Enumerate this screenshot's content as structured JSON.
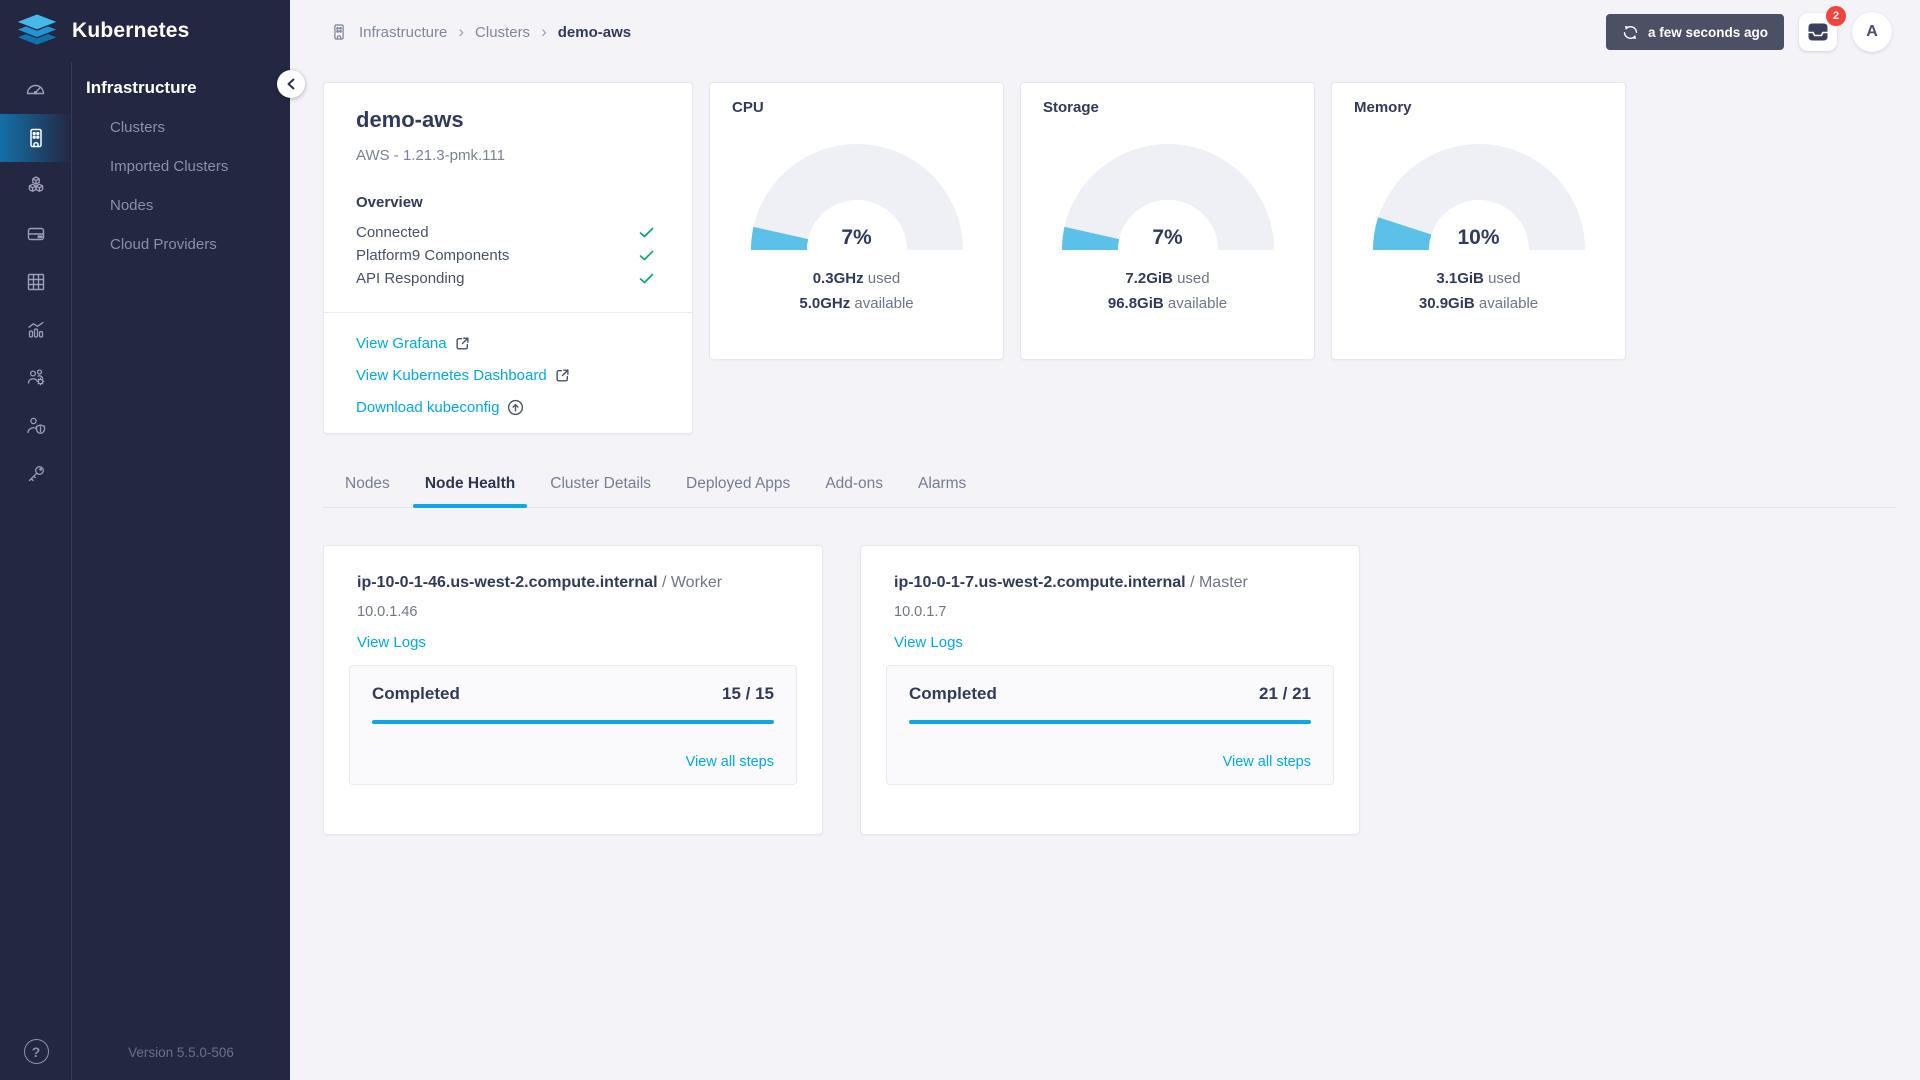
{
  "app": {
    "product_name": "Kubernetes",
    "version": "Version 5.5.0-506"
  },
  "sidebar": {
    "section_title": "Infrastructure",
    "items": [
      {
        "label": "Clusters"
      },
      {
        "label": "Imported Clusters"
      },
      {
        "label": "Nodes"
      },
      {
        "label": "Cloud Providers"
      }
    ],
    "rail_icons": [
      {
        "name": "dashboard-gauge-icon",
        "active": false
      },
      {
        "name": "infrastructure-building-icon",
        "active": true
      },
      {
        "name": "apps-cubes-icon",
        "active": false
      },
      {
        "name": "hosts-server-icon",
        "active": false
      },
      {
        "name": "workloads-grid-icon",
        "active": false
      },
      {
        "name": "monitoring-chart-icon",
        "active": false
      },
      {
        "name": "user-management-icon",
        "active": false
      },
      {
        "name": "access-shield-icon",
        "active": false
      },
      {
        "name": "api-key-icon",
        "active": false
      }
    ],
    "help_icon": "help-icon",
    "collapse_icon": "chevron-left-icon"
  },
  "breadcrumb": {
    "icon": "infrastructure-building-icon",
    "items": [
      "Infrastructure",
      "Clusters"
    ],
    "current": "demo-aws"
  },
  "topbar": {
    "last_refreshed": "a few seconds ago",
    "refresh_icon": "refresh-icon",
    "inbox_icon": "inbox-tray-icon",
    "notification_count": "2",
    "avatar_initial": "A"
  },
  "cluster_card": {
    "title": "demo-aws",
    "subtitle": "AWS - 1.21.3-pmk.111",
    "overview_title": "Overview",
    "checks": [
      {
        "label": "Connected",
        "status": "ok"
      },
      {
        "label": "Platform9 Components",
        "status": "ok"
      },
      {
        "label": "API Responding",
        "status": "ok"
      }
    ],
    "links": [
      {
        "label": "View Grafana",
        "icon": "external-link-icon"
      },
      {
        "label": "View Kubernetes Dashboard",
        "icon": "external-link-icon"
      },
      {
        "label": "Download kubeconfig",
        "icon": "upload-circle-icon"
      }
    ]
  },
  "chart_data": [
    {
      "type": "gauge",
      "title": "CPU",
      "percent": 7,
      "percent_label": "7%",
      "used_value": "0.3GHz",
      "used_suffix": "used",
      "available_value": "5.0GHz",
      "available_suffix": "available"
    },
    {
      "type": "gauge",
      "title": "Storage",
      "percent": 7,
      "percent_label": "7%",
      "used_value": "7.2GiB",
      "used_suffix": "used",
      "available_value": "96.8GiB",
      "available_suffix": "available"
    },
    {
      "type": "gauge",
      "title": "Memory",
      "percent": 10,
      "percent_label": "10%",
      "used_value": "3.1GiB",
      "used_suffix": "used",
      "available_value": "30.9GiB",
      "available_suffix": "available"
    }
  ],
  "tabs": [
    {
      "label": "Nodes",
      "active": false
    },
    {
      "label": "Node Health",
      "active": true
    },
    {
      "label": "Cluster Details",
      "active": false
    },
    {
      "label": "Deployed Apps",
      "active": false
    },
    {
      "label": "Add-ons",
      "active": false
    },
    {
      "label": "Alarms",
      "active": false
    }
  ],
  "nodes": [
    {
      "hostname": "ip-10-0-1-46.us-west-2.compute.internal",
      "role_prefix": "/ ",
      "role": "Worker",
      "ip": "10.0.1.46",
      "view_logs_label": "View Logs",
      "progress": {
        "label": "Completed",
        "count": "15 / 15",
        "percent": 100,
        "view_all_label": "View all steps"
      }
    },
    {
      "hostname": "ip-10-0-1-7.us-west-2.compute.internal",
      "role_prefix": "/ ",
      "role": "Master",
      "ip": "10.0.1.7",
      "view_logs_label": "View Logs",
      "progress": {
        "label": "Completed",
        "count": "21 / 21",
        "percent": 100,
        "view_all_label": "View all steps"
      }
    }
  ],
  "colors": {
    "page_bg": "#f4f4f8",
    "sidebar_bg": "#232742",
    "accent_blue": "#0da6e6",
    "link_cyan": "#00a9e8",
    "gauge_fill": "#5cc1e8",
    "gauge_track": "#eef0f6",
    "success_green": "#00a676",
    "badge_red": "#f0443c",
    "dark_text": "#323a5c",
    "refresh_button_bg": "#4b5065"
  }
}
